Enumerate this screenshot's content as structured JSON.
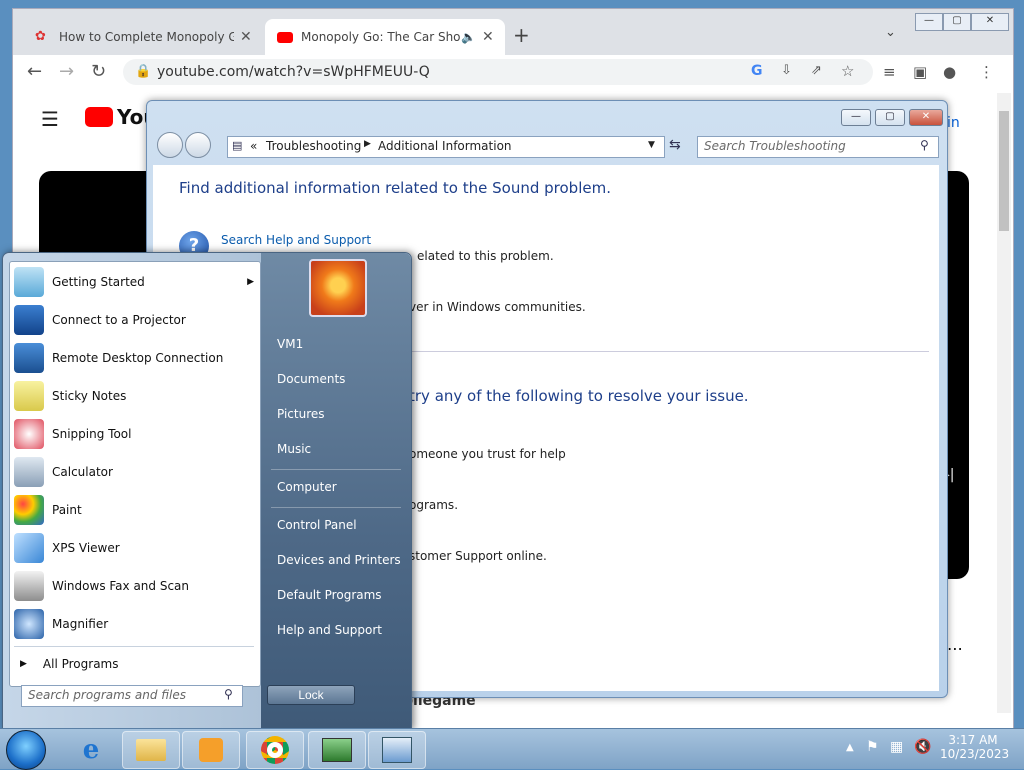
{
  "chrome": {
    "tabs": [
      {
        "title": "How to Complete Monopoly GO",
        "close": "✕"
      },
      {
        "title": "Monopoly Go: The Car Show",
        "close": "✕"
      }
    ],
    "new_tab": "+",
    "url": "youtube.com/watch?v=sWpHFMEUU-Q"
  },
  "youtube": {
    "logo": "YouT",
    "signin": "in",
    "channel_text": "bilegame"
  },
  "troubleshooting": {
    "breadcrumb_sep": "«",
    "crumb1": "Troubleshooting",
    "crumb2": "Additional Information",
    "search_placeholder": "Search Troubleshooting",
    "heading1": "Find additional information related to the Sound problem.",
    "link1": "Search Help and Support",
    "line1": "elated to this problem.",
    "line2": "ver in Windows communities.",
    "heading2": "try any of the following to resolve your issue.",
    "line3": "omeone you trust for help",
    "line4": "ograms.",
    "line5": "stomer Support online."
  },
  "start_menu": {
    "programs": [
      {
        "label": "Getting Started",
        "arrow": "▶"
      },
      {
        "label": "Connect to a Projector"
      },
      {
        "label": "Remote Desktop Connection"
      },
      {
        "label": "Sticky Notes"
      },
      {
        "label": "Snipping Tool"
      },
      {
        "label": "Calculator"
      },
      {
        "label": "Paint"
      },
      {
        "label": "XPS Viewer"
      },
      {
        "label": "Windows Fax and Scan"
      },
      {
        "label": "Magnifier"
      }
    ],
    "all_programs": "All Programs",
    "search_placeholder": "Search programs and files",
    "right": [
      "VM1",
      "Documents",
      "Pictures",
      "Music",
      "Computer",
      "Control Panel",
      "Devices and Printers",
      "Default Programs",
      "Help and Support"
    ],
    "lock": "Lock"
  },
  "taskbar": {
    "time": "3:17 AM",
    "date": "10/23/2023"
  },
  "colors": {
    "accent": "#1e3f8a",
    "yt_red": "#ff0000"
  }
}
